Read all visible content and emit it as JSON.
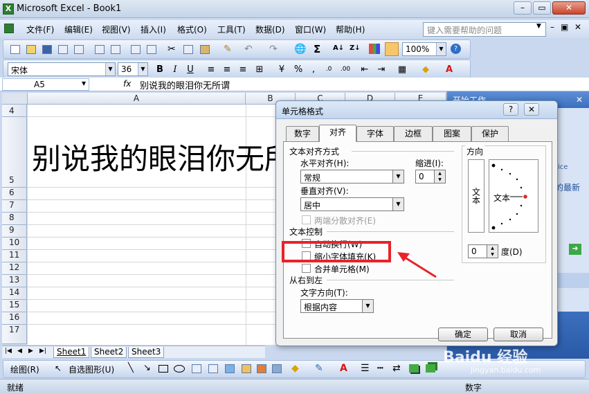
{
  "window": {
    "title": "Microsoft Excel - Book1",
    "icon": "excel-icon"
  },
  "menu": {
    "items": [
      "文件(F)",
      "编辑(E)",
      "视图(V)",
      "插入(I)",
      "格式(O)",
      "工具(T)",
      "数据(D)",
      "窗口(W)",
      "帮助(H)"
    ],
    "help_placeholder": "键入需要帮助的问题"
  },
  "toolbar": {
    "zoom": "100%",
    "font": "宋体",
    "font_size": "36"
  },
  "formula": {
    "cell_ref": "A5",
    "fx": "fx",
    "content": "别说我的眼泪你无所谓"
  },
  "sheet": {
    "columns": [
      "A",
      "B",
      "C",
      "D",
      "E"
    ],
    "rows": [
      "4",
      "5",
      "6",
      "7",
      "8",
      "9",
      "10",
      "11",
      "12",
      "13",
      "14",
      "15",
      "16",
      "17"
    ],
    "cell_text": "别说我的眼泪你无所谓",
    "tabs": [
      "Sheet1",
      "Sheet2",
      "Sheet3"
    ]
  },
  "drawbar": {
    "draw": "绘图(R)",
    "autoshapes": "自选图形(U)"
  },
  "status": {
    "left": "就绪",
    "right": "数字"
  },
  "taskpane": {
    "title": "开始工作",
    "frag1": "ice",
    "frag2": "的最新",
    "frag3": "e"
  },
  "dialog": {
    "title": "单元格格式",
    "tabs": [
      "数字",
      "对齐",
      "字体",
      "边框",
      "图案",
      "保护"
    ],
    "active_tab": "对齐",
    "text_align_section": "文本对齐方式",
    "horizontal_label": "水平对齐(H):",
    "horizontal_value": "常规",
    "indent_label": "缩进(I):",
    "indent_value": "0",
    "vertical_label": "垂直对齐(V):",
    "vertical_value": "居中",
    "justify_distributed": "两端分散对齐(E)",
    "text_control_section": "文本控制",
    "wrap_text": "自动换行(W)",
    "shrink_to_fit": "缩小字体填充(K)",
    "merge_cells": "合并单元格(M)",
    "rtl_section": "从右到左",
    "direction_label": "文字方向(T):",
    "direction_value": "根据内容",
    "orientation_section": "方向",
    "vertical_text": "文本",
    "orientation_text": "文本",
    "degree_value": "0",
    "degree_label": "度(D)",
    "ok": "确定",
    "cancel": "取消"
  },
  "watermark": {
    "text": "Baidu 经验",
    "sub": "jingyan.baidu.com"
  },
  "accent_color": "#e8232a"
}
